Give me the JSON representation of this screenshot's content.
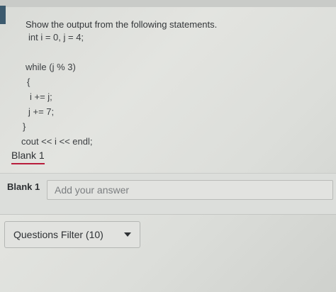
{
  "question": {
    "prompt": "Show the output from the following statements."
  },
  "code_lines": [
    "int i = 0, j = 4;",
    "while (j % 3)",
    "{",
    "i += j;",
    "j += 7;",
    "}",
    "cout << i << endl;"
  ],
  "blank": {
    "heading": "Blank 1"
  },
  "answer": {
    "label": "Blank 1",
    "placeholder": "Add your answer",
    "value": ""
  },
  "filter": {
    "label": "Questions Filter (10)",
    "icon": "chevron-down-icon"
  },
  "colors": {
    "blank_underline": "#b81d3c",
    "left_bar": "#3c5a6e"
  }
}
